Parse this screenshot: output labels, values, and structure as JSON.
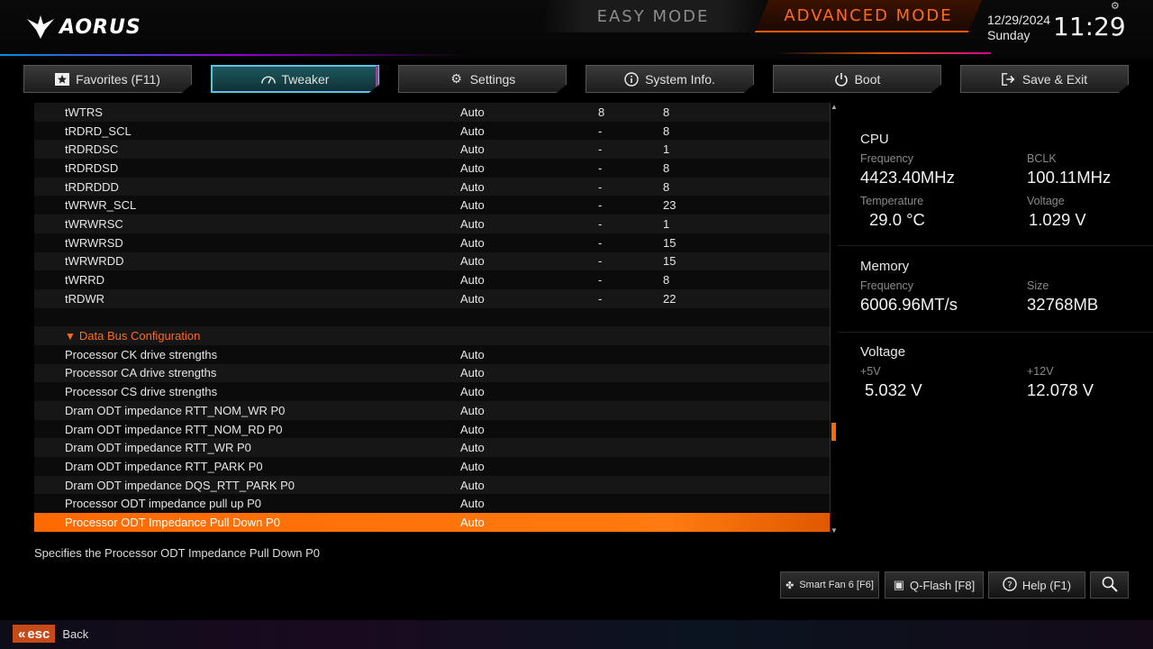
{
  "header": {
    "logo_text": "AORUS",
    "easy_mode": "EASY MODE",
    "advanced_mode": "ADVANCED MODE",
    "date": "12/29/2024",
    "day": "Sunday",
    "time": "11:29"
  },
  "tabs": [
    {
      "label": "Favorites (F11)",
      "icon": "star-icon"
    },
    {
      "label": "Tweaker",
      "icon": "speedometer-icon",
      "active": true
    },
    {
      "label": "Settings",
      "icon": "gear-icon"
    },
    {
      "label": "System Info.",
      "icon": "info-icon"
    },
    {
      "label": "Boot",
      "icon": "power-icon"
    },
    {
      "label": "Save & Exit",
      "icon": "exit-icon"
    }
  ],
  "rows": [
    {
      "name": "tWTRS",
      "value": "Auto",
      "current": "8",
      "default": "8"
    },
    {
      "name": "tRDRD_SCL",
      "value": "Auto",
      "current": "-",
      "default": "8"
    },
    {
      "name": "tRDRDSC",
      "value": "Auto",
      "current": "-",
      "default": "1"
    },
    {
      "name": "tRDRDSD",
      "value": "Auto",
      "current": "-",
      "default": "8"
    },
    {
      "name": "tRDRDDD",
      "value": "Auto",
      "current": "-",
      "default": "8"
    },
    {
      "name": "tWRWR_SCL",
      "value": "Auto",
      "current": "-",
      "default": "23"
    },
    {
      "name": "tWRWRSC",
      "value": "Auto",
      "current": "-",
      "default": "1"
    },
    {
      "name": "tWRWRSD",
      "value": "Auto",
      "current": "-",
      "default": "15"
    },
    {
      "name": "tWRWRDD",
      "value": "Auto",
      "current": "-",
      "default": "15"
    },
    {
      "name": "tWRRD",
      "value": "Auto",
      "current": "-",
      "default": "8"
    },
    {
      "name": "tRDWR",
      "value": "Auto",
      "current": "-",
      "default": "22"
    },
    {
      "name": "",
      "value": "",
      "current": "",
      "default": ""
    },
    {
      "name": "Data Bus Configuration",
      "section": true
    },
    {
      "name": "Processor CK drive strengths",
      "value": "Auto"
    },
    {
      "name": "Processor CA drive strengths",
      "value": "Auto"
    },
    {
      "name": "Processor CS drive strengths",
      "value": "Auto"
    },
    {
      "name": "Dram ODT impedance RTT_NOM_WR P0",
      "value": "Auto"
    },
    {
      "name": "Dram ODT impedance RTT_NOM_RD P0",
      "value": "Auto"
    },
    {
      "name": "Dram ODT impedance RTT_WR P0",
      "value": "Auto"
    },
    {
      "name": "Dram ODT impedance RTT_PARK P0",
      "value": "Auto"
    },
    {
      "name": "Dram ODT impedance DQS_RTT_PARK P0",
      "value": "Auto"
    },
    {
      "name": "Processor ODT impedance pull up P0",
      "value": "Auto"
    },
    {
      "name": "Processor ODT Impedance Pull Down P0",
      "value": "Auto",
      "selected": true
    }
  ],
  "description": "Specifies the Processor ODT Impedance Pull Down P0",
  "system": {
    "cpu": {
      "title": "CPU",
      "freq_label": "Frequency",
      "freq": "4423.40MHz",
      "bclk_label": "BCLK",
      "bclk": "100.11MHz",
      "temp_label": "Temperature",
      "temp": "29.0 °C",
      "volt_label": "Voltage",
      "volt": "1.029 V"
    },
    "memory": {
      "title": "Memory",
      "freq_label": "Frequency",
      "freq": "6006.96MT/s",
      "size_label": "Size",
      "size": "32768MB"
    },
    "voltage": {
      "title": "Voltage",
      "v5_label": "+5V",
      "v5": "5.032 V",
      "v12_label": "+12V",
      "v12": "12.078 V"
    }
  },
  "bottom": {
    "smart_fan": "Smart Fan 6 [F6]",
    "qflash": "Q-Flash [F8]",
    "help": "Help (F1)",
    "esc_key": "esc",
    "back": "Back"
  },
  "colors": {
    "accent": "#ff6a00",
    "tab_active": "#1d5a5f",
    "section": "#ff6a1a"
  }
}
